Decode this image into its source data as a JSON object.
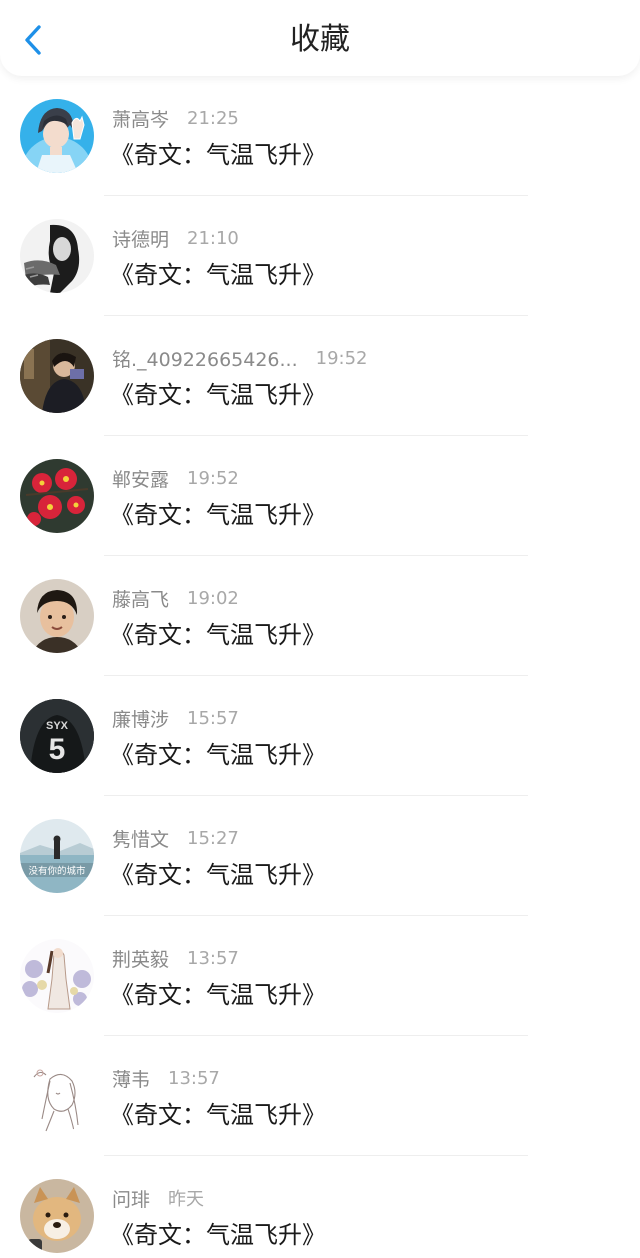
{
  "header": {
    "title": "收藏",
    "back_icon": "chevron-left-icon",
    "accent_color": "#1e90e8"
  },
  "items": [
    {
      "name": "萧高岑",
      "time": "21:25",
      "content": "《奇文：气温飞升》"
    },
    {
      "name": "诗德明",
      "time": "21:10",
      "content": "《奇文：气温飞升》"
    },
    {
      "name": "铭._40922665426...",
      "time": "19:52",
      "content": "《奇文：气温飞升》"
    },
    {
      "name": "郸安露",
      "time": "19:52",
      "content": "《奇文：气温飞升》"
    },
    {
      "name": "藤高飞",
      "time": "19:02",
      "content": "《奇文：气温飞升》"
    },
    {
      "name": "廉博涉",
      "time": "15:57",
      "content": "《奇文：气温飞升》",
      "avatar_text": "SYX 5"
    },
    {
      "name": "隽惜文",
      "time": "15:27",
      "content": "《奇文：气温飞升》",
      "avatar_text": "没有你的城市"
    },
    {
      "name": "荆英毅",
      "time": "13:57",
      "content": "《奇文：气温飞升》"
    },
    {
      "name": "薄韦",
      "time": "13:57",
      "content": "《奇文：气温飞升》"
    },
    {
      "name": "问琲",
      "time": "昨天",
      "content": "《奇文：气温飞升》"
    }
  ]
}
